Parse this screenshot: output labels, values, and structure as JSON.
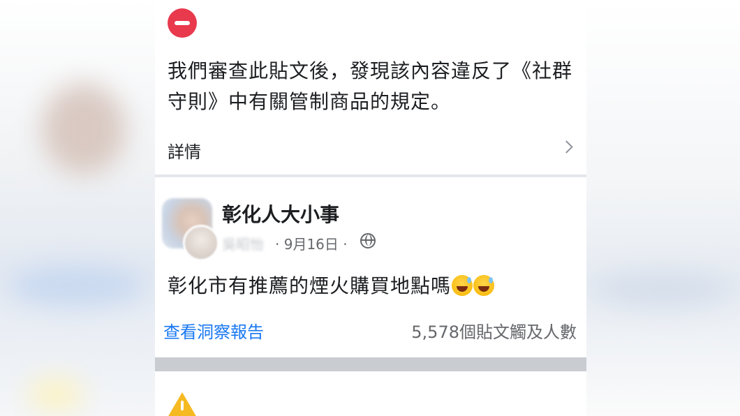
{
  "notice": {
    "message": "我們審查此貼文後，發現該內容違反了《社群守則》中有關管制商品的規定。",
    "details_label": "詳情"
  },
  "post": {
    "group_name": "彰化人大小事",
    "author": "吳昭怡",
    "meta": "· 9月16日 ·",
    "text": "彰化市有推薦的煙火購買地點嗎",
    "insights_link": "查看洞察報告",
    "reach": "5,578個貼文觸及人數"
  },
  "colors": {
    "block_red": "#e8394d",
    "link_blue": "#1877f2",
    "warning_yellow": "#f5b921"
  },
  "icons": [
    "block-icon",
    "chevron-right-icon",
    "globe-icon",
    "grinning-sweat-emoji",
    "warning-icon"
  ]
}
